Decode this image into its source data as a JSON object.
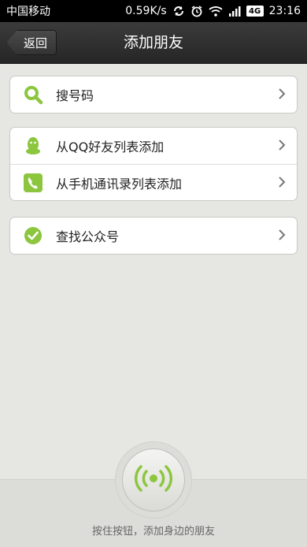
{
  "status_bar": {
    "carrier": "中国移动",
    "network_speed": "0.59K/s",
    "network_type": "4G",
    "time": "23:16",
    "icons": [
      "sync-icon",
      "alarm-icon",
      "wifi-icon",
      "signal-icon",
      "battery-icon"
    ]
  },
  "header": {
    "back_label": "返回",
    "title": "添加朋友"
  },
  "groups": [
    {
      "rows": [
        {
          "label": "搜号码",
          "icon": "search-icon"
        }
      ]
    },
    {
      "rows": [
        {
          "label": "从QQ好友列表添加",
          "icon": "qq-icon"
        },
        {
          "label": "从手机通讯录列表添加",
          "icon": "phone-icon"
        }
      ]
    },
    {
      "rows": [
        {
          "label": "查找公众号",
          "icon": "check-icon"
        }
      ]
    }
  ],
  "bottom": {
    "hint": "按住按钮，添加身边的朋友",
    "radar_icon": "radar-icon"
  },
  "colors": {
    "accent_green": "#8cc63f",
    "background": "#e6e6e3",
    "titlebar": "#2e2e2e"
  }
}
